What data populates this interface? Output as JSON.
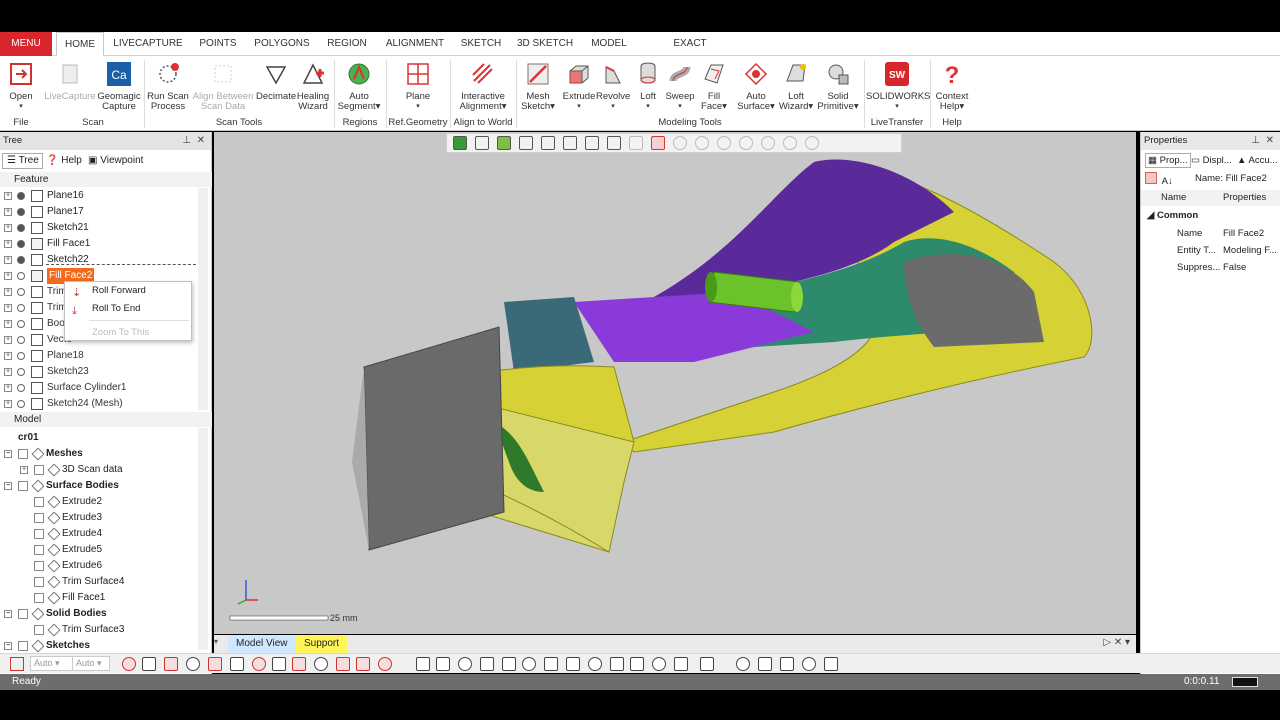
{
  "ribbon_tabs": [
    "MENU",
    "HOME",
    "LIVECAPTURE",
    "POINTS",
    "POLYGONS",
    "REGION",
    "ALIGNMENT",
    "SKETCH",
    "3D SKETCH",
    "MODEL",
    "EXACT SURFACING"
  ],
  "ribbon": {
    "open": "Open",
    "livecapture": "LiveCapture",
    "geomagic_capture_1": "Geomagic",
    "geomagic_capture_2": "Capture",
    "run_scan_1": "Run Scan",
    "run_scan_2": "Process",
    "align_scan_1": "Align Between",
    "align_scan_2": "Scan Data",
    "decimate": "Decimate",
    "healing_1": "Healing",
    "healing_2": "Wizard",
    "auto_segment_1": "Auto",
    "auto_segment_2": "Segment",
    "plane": "Plane",
    "interactive_1": "Interactive",
    "interactive_2": "Alignment",
    "mesh_sketch_1": "Mesh",
    "mesh_sketch_2": "Sketch",
    "extrude": "Extrude",
    "revolve": "Revolve",
    "loft": "Loft",
    "sweep": "Sweep",
    "fill_face_1": "Fill",
    "fill_face_2": "Face",
    "auto_surface_1": "Auto",
    "auto_surface_2": "Surface",
    "loft_wizard_1": "Loft",
    "loft_wizard_2": "Wizard",
    "solid_primitive_1": "Solid",
    "solid_primitive_2": "Primitive",
    "solidworks": "SOLIDWORKS",
    "solidworks_logo": "SW",
    "context_help_1": "Context",
    "context_help_2": "Help",
    "ca_logo": "Ca",
    "groups": [
      "File",
      "Scan",
      "Scan Tools",
      "Regions",
      "Ref.Geometry",
      "Align to World",
      "Modeling Tools",
      "LiveTransfer",
      "Help"
    ]
  },
  "tree": {
    "title": "Tree",
    "tab_tree": "Tree",
    "tab_help": "Help",
    "tab_viewpoint": "Viewpoint",
    "feature_header": "Feature",
    "features": [
      "Plane16",
      "Plane17",
      "Sketch21",
      "Fill Face1",
      "Sketch22",
      "Fill Face2",
      "Trim",
      "Trim",
      "Boo",
      "Vecto",
      "Plane18",
      "Sketch23",
      "Surface Cylinder1",
      "Sketch24 (Mesh)"
    ],
    "model_header": "Model",
    "model_root": "cr01",
    "model_items": [
      "Meshes",
      "3D Scan data",
      "Surface Bodies",
      "Extrude2",
      "Extrude3",
      "Extrude4",
      "Extrude5",
      "Extrude6",
      "Trim Surface4",
      "Fill Face1",
      "Solid Bodies",
      "Trim Surface3",
      "Sketches"
    ]
  },
  "context_menu": {
    "roll_forward": "Roll Forward",
    "roll_to_end": "Roll To End",
    "zoom_to_this": "Zoom To This"
  },
  "viewport": {
    "scale_label": "25 mm",
    "tab_model_view": "Model View",
    "tab_support": "Support"
  },
  "properties": {
    "title": "Properties",
    "tab_prop": "Prop...",
    "tab_disp": "Displ...",
    "tab_accu": "Accu...",
    "name_header": "Name: Fill Face2",
    "col_name": "Name",
    "col_props": "Properties",
    "section": "Common",
    "rows": [
      {
        "k": "Name",
        "v": "Fill Face2"
      },
      {
        "k": "Entity T...",
        "v": "Modeling F..."
      },
      {
        "k": "Suppres...",
        "v": "False"
      }
    ]
  },
  "bottom_toolbar": {
    "auto1": "Auto",
    "auto2": "Auto"
  },
  "status": {
    "text": "Ready",
    "time": "0:0:0.11"
  },
  "colors": {
    "menu_red": "#d7262c",
    "viewport_bg": "#c8c8c8",
    "highlight_orange": "#f26b1d",
    "support_tab": "#fff45c"
  }
}
